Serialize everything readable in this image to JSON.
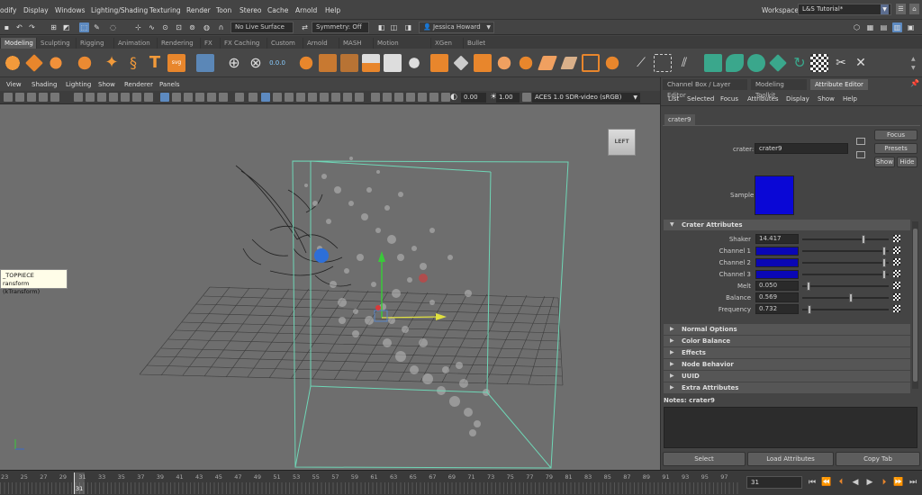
{
  "menubar": {
    "items": [
      "odify",
      "Display",
      "Windows",
      "Lighting/Shading",
      "Texturing",
      "Render",
      "Toon",
      "Stereo",
      "Cache",
      "Arnold",
      "Help"
    ],
    "workspace_label": "Workspace:",
    "workspace_value": "L&S Tutorial*"
  },
  "statusline": {
    "live_surface": "No Live Surface",
    "symmetry": "Symmetry: Off",
    "user": "Jessica Howard"
  },
  "shelf_tabs": [
    "Modeling",
    "Sculpting",
    "Rigging",
    "Animation",
    "Rendering",
    "FX",
    "FX Caching",
    "Custom",
    "Arnold",
    "MASH",
    "Motion Graphics",
    "XGen",
    "Bullet"
  ],
  "shelf_active_tab": "Modeling",
  "viewport": {
    "menu": [
      "View",
      "Shading",
      "Lighting",
      "Show",
      "Renderer",
      "Panels"
    ],
    "exposure": "0.00",
    "gamma": "1.00",
    "color_space": "ACES 1.0 SDR-video (sRGB)",
    "view_cube_label": "LEFT",
    "tooltip_line1": "_TOPPIECE",
    "tooltip_line2": "ransform (kTransform)"
  },
  "right_panel": {
    "tabs": [
      "Channel Box / Layer Editor",
      "Modeling Toolkit",
      "Attribute Editor"
    ],
    "active_tab": "Attribute Editor",
    "menu": [
      "List",
      "Selected",
      "Focus",
      "Attributes",
      "Display",
      "Show",
      "Help"
    ],
    "node_tab": "crater9",
    "node_label": "crater:",
    "node_value": "crater9",
    "focus_button": "Focus",
    "presets_button": "Presets",
    "show_button": "Show",
    "hide_button": "Hide",
    "sample_label": "Sample",
    "sample_color": "#0a07d6",
    "crater_section": "Crater Attributes",
    "attributes": [
      {
        "label": "Shaker",
        "value": "14.417",
        "kind": "number",
        "fraction": 0.72
      },
      {
        "label": "Channel 1",
        "value": "",
        "kind": "color",
        "fraction": 0.97
      },
      {
        "label": "Channel 2",
        "value": "",
        "kind": "color",
        "fraction": 0.97
      },
      {
        "label": "Channel 3",
        "value": "",
        "kind": "color",
        "fraction": 0.97
      },
      {
        "label": "Melt",
        "value": "0.050",
        "kind": "number",
        "fraction": 0.05
      },
      {
        "label": "Balance",
        "value": "0.569",
        "kind": "number",
        "fraction": 0.57
      },
      {
        "label": "Frequency",
        "value": "0.732",
        "kind": "number",
        "fraction": 0.07
      }
    ],
    "sections": [
      "Normal Options",
      "Color Balance",
      "Effects",
      "Node Behavior",
      "UUID",
      "Extra Attributes"
    ],
    "notes_label": "Notes:  crater9",
    "select_button": "Select",
    "load_attributes_button": "Load Attributes",
    "copy_tab_button": "Copy Tab"
  },
  "timeline": {
    "ticks": [
      "23",
      "25",
      "27",
      "29",
      "31",
      "33",
      "35",
      "37",
      "39",
      "41",
      "43",
      "45",
      "47",
      "49",
      "51",
      "53",
      "55",
      "57",
      "59",
      "61",
      "63",
      "65",
      "67",
      "69",
      "71",
      "73",
      "75",
      "77",
      "79",
      "81",
      "83",
      "85",
      "87",
      "89",
      "91",
      "93",
      "95",
      "97"
    ],
    "current_frame": "31",
    "current_frame_field": "31"
  }
}
